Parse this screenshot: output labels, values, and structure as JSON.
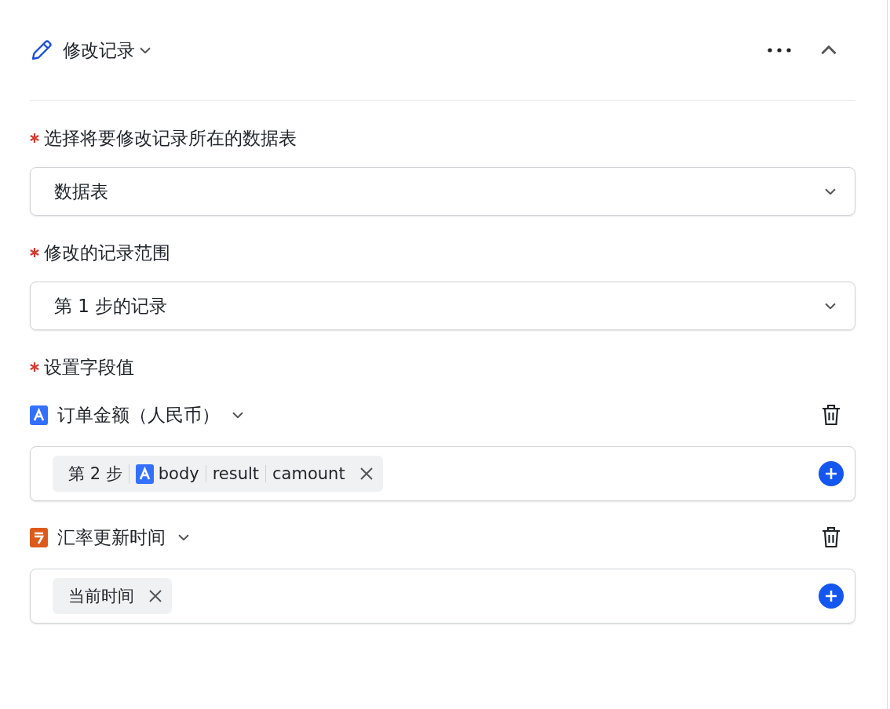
{
  "header": {
    "title": "修改记录"
  },
  "selects": [
    {
      "required": true,
      "label": "选择将要修改记录所在的数据表",
      "value": "数据表"
    },
    {
      "required": true,
      "label": "修改的记录范围",
      "value": "第 1 步的记录"
    }
  ],
  "field_values": {
    "required": true,
    "label": "设置字段值",
    "fields": [
      {
        "name": "订单金额（人民币）",
        "kind": "text",
        "tags": [
          {
            "parts": [
              {
                "text": "第 2 步"
              },
              {
                "text": "body",
                "kind": "text"
              },
              {
                "text": "result"
              },
              {
                "text": "camount"
              }
            ]
          }
        ]
      },
      {
        "name": "汇率更新时间",
        "kind": "date",
        "tags": [
          {
            "parts": [
              {
                "text": "当前时间"
              }
            ]
          }
        ]
      }
    ]
  }
}
